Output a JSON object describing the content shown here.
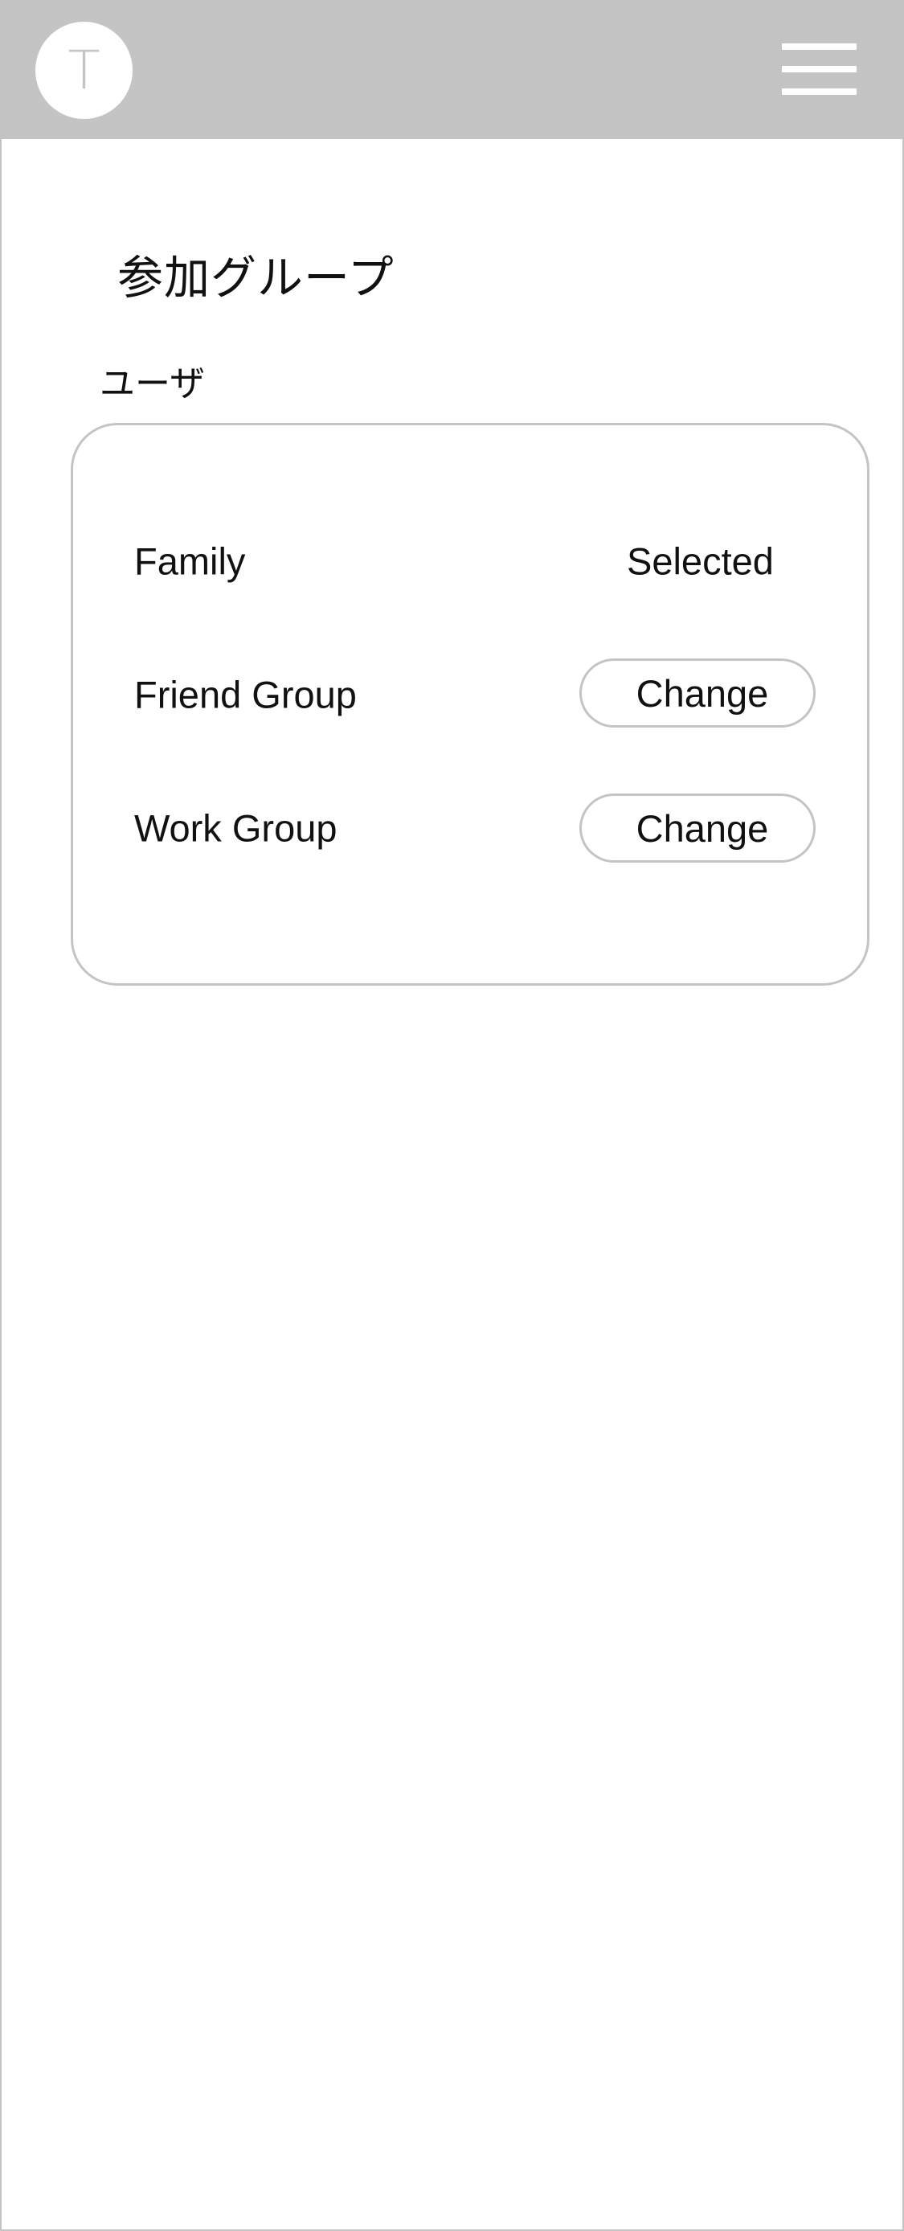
{
  "header": {
    "avatar_initial": "T",
    "menu_icon": "hamburger-menu-icon"
  },
  "page": {
    "title": "参加グループ",
    "section_label": "ユーザ"
  },
  "groups": [
    {
      "name": "Family",
      "status": "Selected"
    },
    {
      "name": "Friend Group",
      "action_label": "Change"
    },
    {
      "name": "Work Group",
      "action_label": "Change"
    }
  ],
  "colors": {
    "header_bg": "#c4c4c4",
    "border": "#c4c4c4",
    "text": "#111111",
    "background": "#ffffff"
  }
}
